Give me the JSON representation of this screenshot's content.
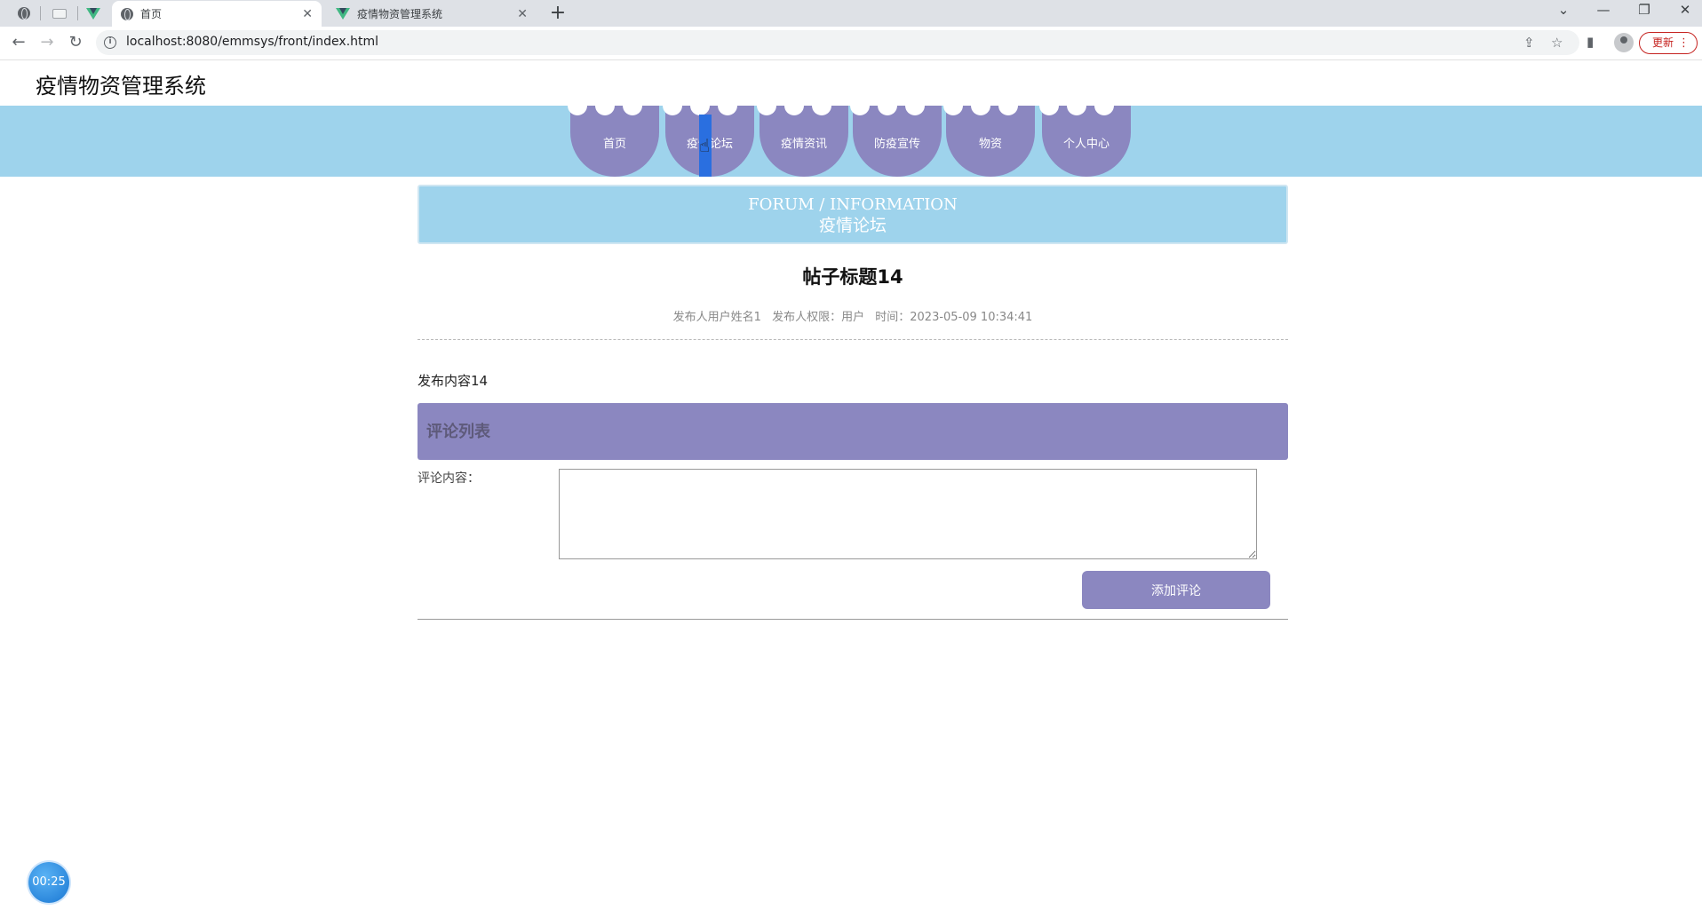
{
  "browser": {
    "tabs": [
      {
        "title": "首页",
        "active": true
      },
      {
        "title": "疫情物资管理系统",
        "active": false
      }
    ],
    "url": "localhost:8080/emmsys/front/index.html",
    "update_label": "更新"
  },
  "site": {
    "title": "疫情物资管理系统"
  },
  "nav": {
    "items": [
      {
        "label": "首页"
      },
      {
        "label": "疫情论坛"
      },
      {
        "label": "疫情资讯"
      },
      {
        "label": "防疫宣传"
      },
      {
        "label": "物资"
      },
      {
        "label": "个人中心"
      }
    ]
  },
  "banner": {
    "en": "FORUM / INFORMATION",
    "cn": "疫情论坛"
  },
  "post": {
    "title": "帖子标题14",
    "publisher": "发布人用户姓名1",
    "permission": "发布人权限：用户",
    "time": "时间：2023-05-09 10:34:41",
    "content": "发布内容14"
  },
  "comments": {
    "heading": "评论列表",
    "label": "评论内容：",
    "value": "",
    "submit_label": "添加评论"
  },
  "timer": {
    "value": "00:25"
  }
}
